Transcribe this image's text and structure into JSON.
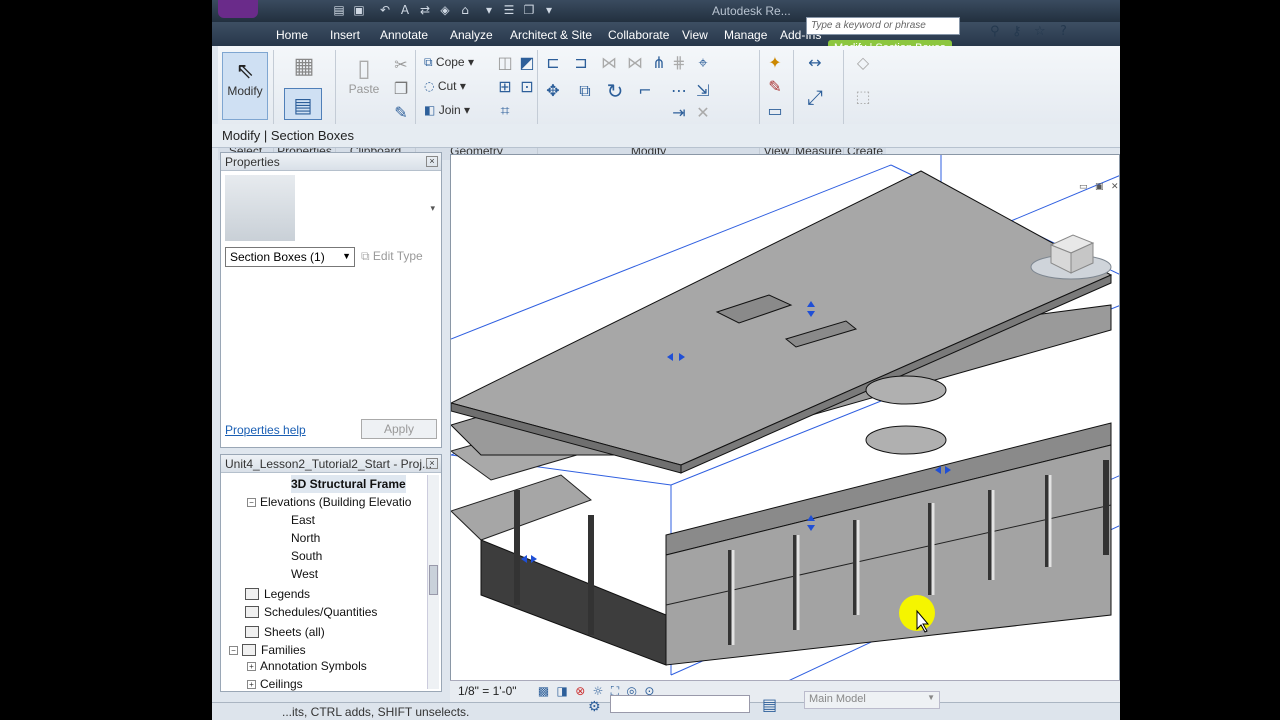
{
  "app": {
    "title": "Autodesk Re...",
    "search_placeholder": "Type a keyword or phrase"
  },
  "tabs": [
    {
      "label": "Home"
    },
    {
      "label": "Insert"
    },
    {
      "label": "Annotate"
    },
    {
      "label": "Analyze"
    },
    {
      "label": "Architect & Site"
    },
    {
      "label": "Collaborate"
    },
    {
      "label": "View"
    },
    {
      "label": "Manage"
    },
    {
      "label": "Add-Ins"
    },
    {
      "label": "Modify | Section Boxes"
    }
  ],
  "ribbon": {
    "select": {
      "button": "Modify",
      "panel": "Select"
    },
    "properties": {
      "panel": "Properties"
    },
    "clipboard": {
      "paste": "Paste",
      "panel": "Clipboard"
    },
    "geometry": {
      "cope": "Cope",
      "cut": "Cut",
      "join": "Join",
      "panel": "Geometry"
    },
    "modify": {
      "panel": "Modify"
    },
    "view": {
      "panel": "View"
    },
    "measure": {
      "panel": "Measure"
    },
    "create": {
      "panel": "Create"
    }
  },
  "context_bar": {
    "label": "Modify | Section Boxes"
  },
  "properties_palette": {
    "title": "Properties",
    "type_selector": "Section Boxes (1)",
    "edit_type": "Edit Type",
    "help_link": "Properties help",
    "apply": "Apply"
  },
  "project_browser": {
    "title": "Unit4_Lesson2_Tutorial2_Start - Proj...",
    "items": {
      "structural_frame": "3D Structural Frame",
      "elevations": "Elevations (Building Elevatio",
      "east": "East",
      "north": "North",
      "south": "South",
      "west": "West",
      "legends": "Legends",
      "schedules": "Schedules/Quantities",
      "sheets": "Sheets (all)",
      "families": "Families",
      "annotation_symbols": "Annotation Symbols",
      "ceilings": "Ceilings"
    }
  },
  "view_control": {
    "scale": "1/8\" = 1'-0\""
  },
  "status": {
    "message": "...its, CTRL adds, SHIFT unselects.",
    "workset": "Main Model"
  },
  "colors": {
    "accent_green": "#8cc63f",
    "ribbon_bg": "#e8edf3",
    "tab_bar": "#2f3f52",
    "cursor_highlight": "#f5f500"
  }
}
